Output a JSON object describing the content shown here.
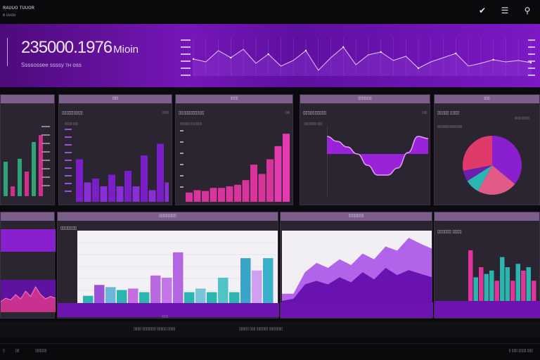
{
  "app": {
    "title": "ʀᴀᴜᴜᴏ ᴛᴜᴜᴏʀ",
    "subtitle": "ʀ  ᴜᴜᴏᴏ"
  },
  "toolbar": {
    "check_icon": "check-icon",
    "menu_icon": "menu-icon",
    "search_icon": "search-icon"
  },
  "hero": {
    "value": "235000.1976",
    "unit": "Mioin",
    "caption": "Ssssossee  ssssy  ᴛʜ ᴏss"
  },
  "panels": {
    "p1": {
      "header": "",
      "labels": [
        "▯▯▯",
        "▯▯▯",
        "▯▯▯",
        "▯▯▯"
      ]
    },
    "p2": {
      "header": "▯▯▯",
      "title": "▯▯▯▯▯▯▯▯▯",
      "corner": "▯▯▯▯",
      "side": "▯▯▯▯▯ ▯▯▯"
    },
    "p3": {
      "header": "▯▯▯▯",
      "title": "▯▯▯▯▯▯▯▯▯▯▯",
      "corner": "▯▯▯",
      "side": "▯▯▯▯▯▯ ▯▯▯ ▯▯▯▯"
    },
    "p4": {
      "header": "▯▯▯▯▯▯▯",
      "title": "▯▯▯▯▯▯▯▯▯▯",
      "corner": "▯▯▯",
      "side": "▯▯▯▯▯▯▯▯ ▯▯▯"
    },
    "p5": {
      "header": "▯▯▯",
      "title": "▯▯▯▯▯ ▯▯▯▯",
      "corner": "▯▯▯▯ ▯▯▯▯▯",
      "side": "▯▯▯▯▯▯▯▯▯▯▯▯▯▯▯▯"
    },
    "p6": {
      "header": ""
    },
    "p7": {
      "header": "▯▯▯▯▯▯▯▯▯",
      "title": "▯▯▯▯▯▯▯",
      "legend": "▯▯▯▯"
    },
    "p8": {
      "header": "▯▯▯▯▯▯▯▯"
    },
    "p9": {
      "header": "",
      "title": "▯▯▯▯▯▯ ▯▯▯▯"
    }
  },
  "statusbar": {
    "left": "▯▯▯▯ ▯▯▯▯▯▯▯ ▯▯▯▯▯ ▯▯▯▯",
    "right": "▯▯▯▯▯  ▯▯▯  ▯▯▯▯▯▯  ▯▯▯▯▯▯▯"
  },
  "footer": {
    "f1": "▯",
    "f2": "▯▯",
    "f3": "▯▯▯▯▯▯",
    "f4": "▯  ▯▯▯  ▯▯▯▯  ▯▯▯"
  },
  "colors": {
    "accent": "#8a1fd0",
    "magenta": "#e0339c",
    "teal": "#2bb5b0",
    "green": "#2ea37a",
    "panel_bg": "#2a2530",
    "panel_header": "#7b5e8a"
  },
  "charts": {
    "hero_line": [
      42,
      46,
      30,
      40,
      28,
      48,
      35,
      52,
      44,
      30,
      58,
      40,
      25,
      50,
      36,
      32,
      44,
      38,
      55,
      46,
      40,
      34,
      52,
      48,
      43,
      46,
      44,
      47
    ],
    "p1_bars": [
      {
        "v": 0.35,
        "c": "#2ea37a"
      },
      {
        "v": 0.1,
        "c": "#d22f8d"
      },
      {
        "v": 0.38,
        "c": "#2ea37a"
      },
      {
        "v": 0.25,
        "c": "#d22f8d"
      },
      {
        "v": 0.55,
        "c": "#2ea37a"
      },
      {
        "v": 0.62,
        "c": "#d22f8d"
      }
    ],
    "p2_bars": [
      0.55,
      0.25,
      0.3,
      0.2,
      0.35,
      0.2,
      0.4,
      0.2,
      0.6,
      0.15,
      0.75,
      0.25
    ],
    "p3_bars": [
      0.12,
      0.15,
      0.14,
      0.18,
      0.18,
      0.2,
      0.22,
      0.28,
      0.48,
      0.36,
      0.55,
      0.72,
      0.88
    ],
    "p4_wave": [
      0.85,
      0.78,
      0.7,
      0.6,
      0.44,
      0.3,
      0.3,
      0.4,
      0.62,
      0.85,
      0.82
    ],
    "p5_pie": [
      {
        "v": 0.36,
        "c": "#8a1fd0"
      },
      {
        "v": 0.22,
        "c": "#e25a86"
      },
      {
        "v": 0.08,
        "c": "#2bb5b0"
      },
      {
        "v": 0.06,
        "c": "#6a1fb0"
      },
      {
        "v": 0.28,
        "c": "#e03a6a"
      }
    ],
    "p6_line": [
      0.3,
      0.4,
      0.35,
      0.5,
      0.38,
      0.6,
      0.45,
      0.72,
      0.5,
      0.38,
      0.45,
      0.4
    ],
    "p7_bars": [
      {
        "v": 0.1,
        "c": "#2bb5b0"
      },
      {
        "v": 0.25,
        "c": "#9a52d8"
      },
      {
        "v": 0.22,
        "c": "#6ab7d8"
      },
      {
        "v": 0.18,
        "c": "#2bb5b0"
      },
      {
        "v": 0.2,
        "c": "#c26ee0"
      },
      {
        "v": 0.15,
        "c": "#2bb5b0"
      },
      {
        "v": 0.38,
        "c": "#b76ae0"
      },
      {
        "v": 0.35,
        "c": "#c276e8"
      },
      {
        "v": 0.7,
        "c": "#b366e2"
      },
      {
        "v": 0.15,
        "c": "#2bb5b0"
      },
      {
        "v": 0.2,
        "c": "#7cc2d8"
      },
      {
        "v": 0.15,
        "c": "#2bb5b0"
      },
      {
        "v": 0.35,
        "c": "#4fc3c5"
      },
      {
        "v": 0.15,
        "c": "#2bb5b0"
      },
      {
        "v": 0.62,
        "c": "#39a4c8"
      },
      {
        "v": 0.45,
        "c": "#cfa0f0"
      },
      {
        "v": 0.62,
        "c": "#39b0c8"
      }
    ],
    "p8_area_a": [
      0.12,
      0.12,
      0.42,
      0.55,
      0.48,
      0.6,
      0.52,
      0.68,
      0.6,
      0.78,
      0.72,
      0.9,
      0.82,
      0.75
    ],
    "p8_area_b": [
      0.02,
      0.05,
      0.25,
      0.3,
      0.25,
      0.35,
      0.28,
      0.42,
      0.32,
      0.48,
      0.38,
      0.45,
      0.4,
      0.35
    ],
    "p9_bars": [
      {
        "v": 0.75,
        "c": "#e0339c"
      },
      {
        "v": 0.35,
        "c": "#2bb5b0"
      },
      {
        "v": 0.5,
        "c": "#e0339c"
      },
      {
        "v": 0.4,
        "c": "#2bb5b0"
      },
      {
        "v": 0.45,
        "c": "#2bb5b0"
      },
      {
        "v": 0.3,
        "c": "#e0339c"
      },
      {
        "v": 0.65,
        "c": "#2bb5b0"
      },
      {
        "v": 0.5,
        "c": "#2bb5b0"
      },
      {
        "v": 0.3,
        "c": "#e0339c"
      },
      {
        "v": 0.55,
        "c": "#2bb5b0"
      },
      {
        "v": 0.45,
        "c": "#e0339c"
      },
      {
        "v": 0.5,
        "c": "#2bb5b0"
      },
      {
        "v": 0.3,
        "c": "#e0339c"
      }
    ]
  }
}
